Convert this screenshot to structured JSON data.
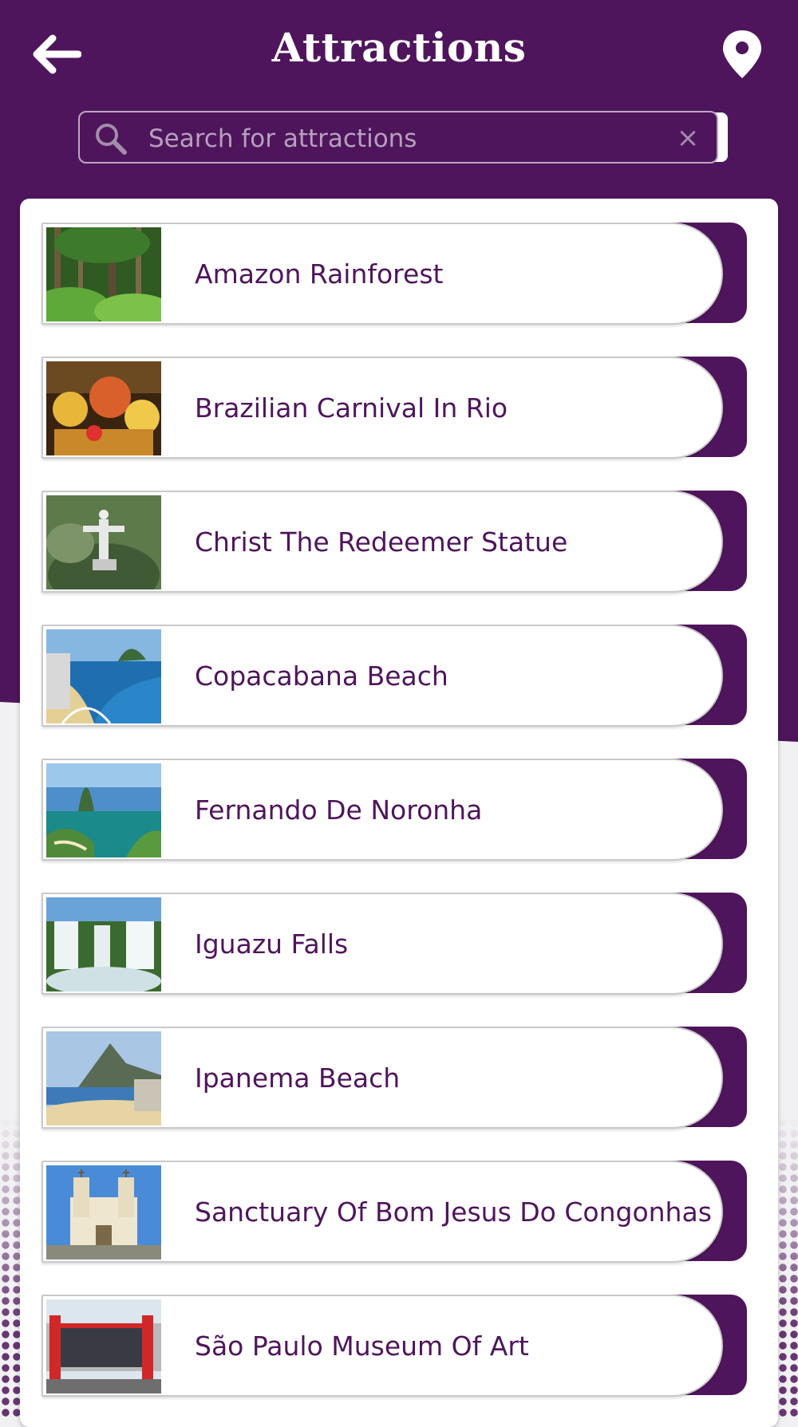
{
  "header": {
    "title": "Attractions",
    "back_icon": "arrow-left-icon",
    "location_icon": "map-pin-icon"
  },
  "search": {
    "placeholder": "Search for attractions",
    "value": "",
    "icon": "search-icon",
    "clear_icon": "close-icon"
  },
  "colors": {
    "brand": "#4f155c",
    "text": "#4f155c",
    "background_light": "#f1f0f2",
    "card": "#ffffff"
  },
  "attractions": [
    {
      "label": "Amazon Rainforest",
      "thumb": "rainforest"
    },
    {
      "label": "Brazilian Carnival In Rio",
      "thumb": "carnival"
    },
    {
      "label": "Christ The Redeemer Statue",
      "thumb": "statue"
    },
    {
      "label": "Copacabana Beach",
      "thumb": "beach-coast"
    },
    {
      "label": "Fernando De Noronha",
      "thumb": "island-bay"
    },
    {
      "label": "Iguazu Falls",
      "thumb": "waterfalls"
    },
    {
      "label": "Ipanema Beach",
      "thumb": "beach-mountain"
    },
    {
      "label": "Sanctuary Of Bom Jesus Do Congonhas",
      "thumb": "church"
    },
    {
      "label": "São Paulo Museum Of Art",
      "thumb": "museum"
    }
  ]
}
